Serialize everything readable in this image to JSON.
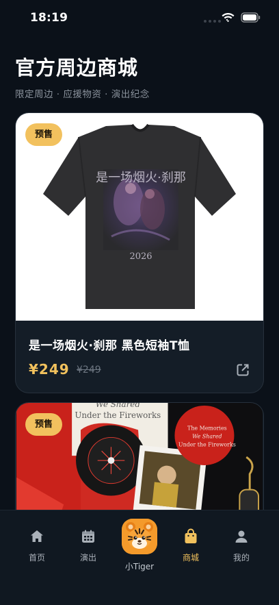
{
  "status_bar": {
    "time": "18:19"
  },
  "header": {
    "title": "官方周边商城",
    "subtitle": "限定周边 · 应援物资 · 演出纪念"
  },
  "products": [
    {
      "badge": "预售",
      "name": "是一场烟火·刹那 黑色短袖T恤",
      "price": "¥249",
      "original_price": "¥249",
      "shirt_print": [
        "是一场烟火·刹那",
        "2026"
      ]
    },
    {
      "badge": "预售",
      "image_text": [
        "The Memories",
        "We Shared",
        "Under the Fireworks"
      ]
    }
  ],
  "tabbar": {
    "items": [
      {
        "label": "首页",
        "icon": "home-icon"
      },
      {
        "label": "演出",
        "icon": "calendar-icon"
      },
      {
        "label": "小Tiger",
        "icon": "tiger-icon"
      },
      {
        "label": "商城",
        "icon": "shopping-bag-icon"
      },
      {
        "label": "我的",
        "icon": "user-icon"
      }
    ],
    "active": "商城"
  },
  "colors": {
    "background": "#0b1119",
    "accent": "#f1c15d",
    "card": "#141d27",
    "badge": "#f2c15e"
  }
}
